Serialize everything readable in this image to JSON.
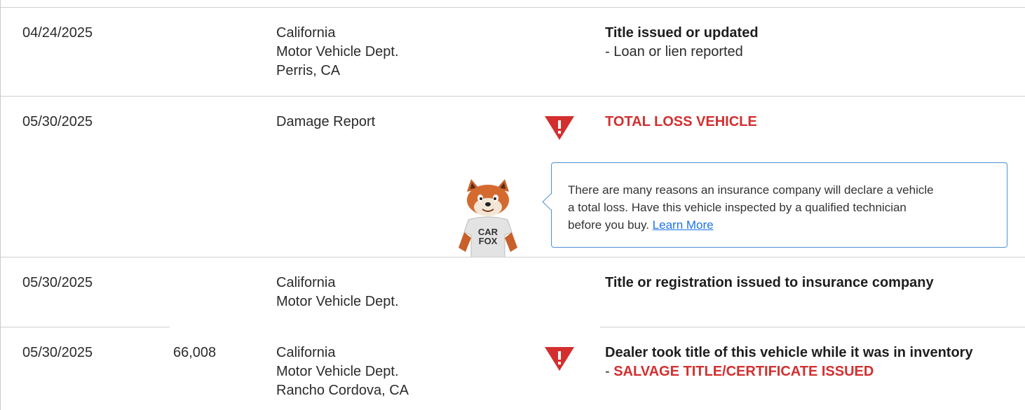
{
  "records": [
    {
      "date": "04/24/2025",
      "odometer": "",
      "source_lines": [
        "California",
        "Motor Vehicle Dept.",
        "Perris, CA"
      ],
      "title": "Title issued or updated",
      "detail": "- Loan or lien reported"
    },
    {
      "date": "05/30/2025",
      "odometer": "",
      "source_lines": [
        "Damage Report"
      ],
      "alert_title": "TOTAL LOSS VEHICLE",
      "tooltip": {
        "text_line1": "There are many reasons an insurance company will declare a vehicle",
        "text_line2": "a total loss. Have this vehicle inspected by a qualified technician",
        "text_line3_prefix": "before you buy.",
        "link": "Learn More"
      },
      "mascot": {
        "shirt_line1": "CAR",
        "shirt_line2": "FOX"
      }
    },
    {
      "date": "05/30/2025",
      "odometer": "",
      "source_lines": [
        "California",
        "Motor Vehicle Dept."
      ],
      "title": "Title or registration issued to insurance company"
    },
    {
      "date": "05/30/2025",
      "odometer": "66,008",
      "source_lines": [
        "California",
        "Motor Vehicle Dept.",
        "Rancho Cordova, CA"
      ],
      "title": "Dealer took title of this vehicle while it was in inventory",
      "detail_prefix": "- ",
      "detail_alert": "SALVAGE TITLE/CERTIFICATE ISSUED"
    }
  ],
  "colors": {
    "alert_red": "#d32f2f",
    "link_blue": "#1a73e8",
    "tooltip_border": "#4a90d9",
    "divider": "#cfcfcf"
  },
  "icons": {
    "alert": "warning-triangle-icon"
  }
}
